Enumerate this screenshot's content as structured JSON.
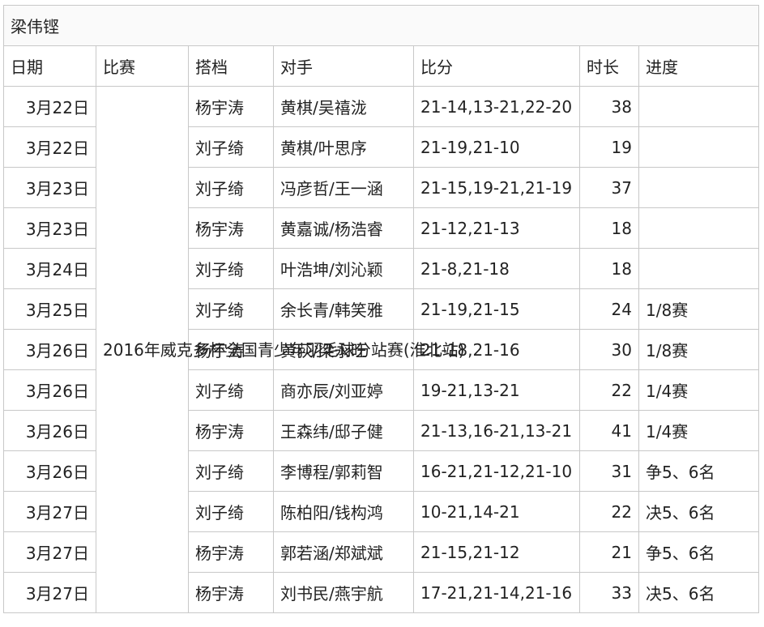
{
  "title": "梁伟铿",
  "headers": [
    "日期",
    "比赛",
    "搭档",
    "对手",
    "比分",
    "时长",
    "进度"
  ],
  "event": "2016年威克多杯全国青少年羽毛球分站赛(淮北站)",
  "rows": [
    {
      "date": "3月22日",
      "partner": "杨宇涛",
      "opponent": "黄棋/吴禧泷",
      "score": "21-14,13-21,22-20",
      "duration": "38",
      "stage": "",
      "bold_score": false
    },
    {
      "date": "3月22日",
      "partner": "刘子绮",
      "opponent": "黄棋/叶思序",
      "score": "21-19,21-10",
      "duration": "19",
      "stage": "",
      "bold_score": false
    },
    {
      "date": "3月23日",
      "partner": "刘子绮",
      "opponent": "冯彦哲/王一涵",
      "score": "21-15,19-21,21-19",
      "duration": "37",
      "stage": "",
      "bold_score": false
    },
    {
      "date": "3月23日",
      "partner": "杨宇涛",
      "opponent": "黄嘉诚/杨浩睿",
      "score": "21-12,21-13",
      "duration": "18",
      "stage": "",
      "bold_score": false
    },
    {
      "date": "3月24日",
      "partner": "刘子绮",
      "opponent": "叶浩坤/刘沁颖",
      "score": "21-8,21-18",
      "duration": "18",
      "stage": "",
      "bold_score": false
    },
    {
      "date": "3月25日",
      "partner": "刘子绮",
      "opponent": "余长青/韩笑雅",
      "score": "21-19,21-15",
      "duration": "24",
      "stage": "1/8赛",
      "bold_score": false
    },
    {
      "date": "3月26日",
      "partner": "杨宇涛",
      "opponent": "黄荻/梁永旺",
      "score": "21-18,21-16",
      "duration": "30",
      "stage": "1/8赛",
      "bold_score": false
    },
    {
      "date": "3月26日",
      "partner": "刘子绮",
      "opponent": "商亦辰/刘亚婷",
      "score": "19-21,13-21",
      "duration": "22",
      "stage": "1/4赛",
      "bold_score": true
    },
    {
      "date": "3月26日",
      "partner": "杨宇涛",
      "opponent": "王森纬/邸子健",
      "score": "21-13,16-21,13-21",
      "duration": "41",
      "stage": "1/4赛",
      "bold_score": false
    },
    {
      "date": "3月26日",
      "partner": "刘子绮",
      "opponent": "李博程/郭莉智",
      "score": "16-21,21-12,21-10",
      "duration": "31",
      "stage": "争5、6名",
      "bold_score": false
    },
    {
      "date": "3月27日",
      "partner": "刘子绮",
      "opponent": "陈柏阳/钱构鸿",
      "score": "10-21,14-21",
      "duration": "22",
      "stage": "决5、6名",
      "bold_score": true
    },
    {
      "date": "3月27日",
      "partner": "杨宇涛",
      "opponent": "郭若涵/郑斌斌",
      "score": "21-15,21-12",
      "duration": "21",
      "stage": "争5、6名",
      "bold_score": false
    },
    {
      "date": "3月27日",
      "partner": "杨宇涛",
      "opponent": "刘书民/燕宇航",
      "score": "17-21,21-14,21-16",
      "duration": "33",
      "stage": "决5、6名",
      "bold_score": false
    }
  ]
}
